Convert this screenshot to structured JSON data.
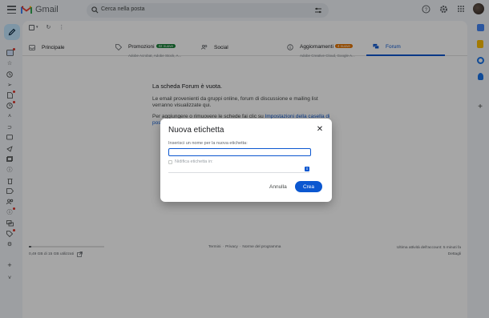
{
  "app": {
    "name": "Gmail",
    "colors": {
      "accent": "#0b57d0",
      "compose": "#c2e7ff",
      "promo_badge": "#188038",
      "update_badge": "#e37400"
    }
  },
  "search": {
    "placeholder": "Cerca nella posta"
  },
  "topbar_icons": [
    "help-icon",
    "settings-gear-icon",
    "apps-grid-icon"
  ],
  "tabs": [
    {
      "label": "Principale",
      "icon": "inbox-icon"
    },
    {
      "label": "Promozioni",
      "badge": "32 nuove",
      "subtitle": "Adobe Acrobat, Adobe Stock, A...",
      "icon": "tag-icon"
    },
    {
      "label": "Social",
      "icon": "people-icon"
    },
    {
      "label": "Aggiornamenti",
      "badge": "4 nuove",
      "subtitle": "Adobe Creative Cloud, Google A...",
      "icon": "info-icon"
    },
    {
      "label": "Forum",
      "icon": "forum-icon"
    }
  ],
  "empty_tab": {
    "title": "La scheda Forum è vuota.",
    "description": "Le email provenienti da gruppi online, forum di discussione e mailing list verranno visualizzate qui.",
    "hint_prefix": "Per aggiungere o rimuovere le schede fai clic su ",
    "hint_link": "Impostazioni della casella di posta"
  },
  "footer": {
    "storage_text": "0,49 GB di 15 GB utilizzati",
    "storage_fraction": 0.033,
    "links": [
      "Termini",
      "Privacy",
      "Norme del programma"
    ],
    "link_sep": "·",
    "activity": "Ultima attività dell'account: 5 minuti fa",
    "details": "Dettagli"
  },
  "dialog": {
    "title": "Nuova etichetta",
    "input_label": "Inserisci un nome per la nuova etichetta:",
    "input_value": "",
    "nest_label": "Nidifica etichetta in:",
    "cancel": "Annulla",
    "create": "Crea"
  }
}
